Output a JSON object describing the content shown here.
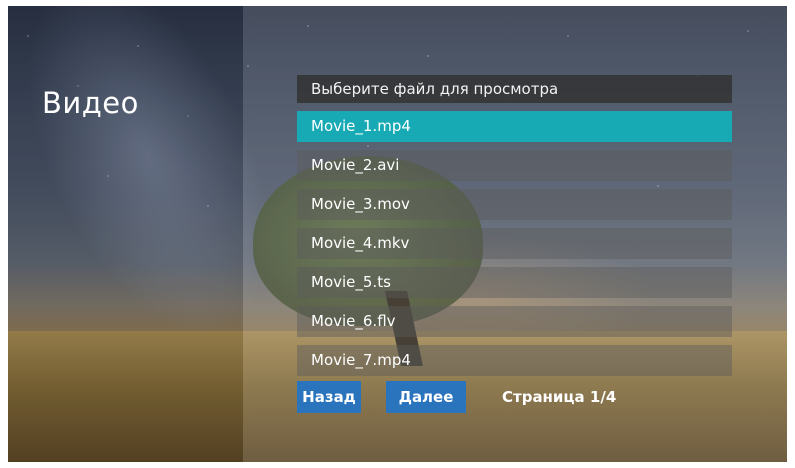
{
  "screen_title": "Видео",
  "file_list": {
    "header": "Выберите файл для просмотра",
    "items": [
      {
        "label": "Movie_1.mp4"
      },
      {
        "label": "Movie_2.avi"
      },
      {
        "label": "Movie_3.mov"
      },
      {
        "label": "Movie_4.mkv"
      },
      {
        "label": "Movie_5.ts"
      },
      {
        "label": "Movie_6.flv"
      },
      {
        "label": "Movie_7.mp4"
      }
    ],
    "selected_label": "Movie_1.mp4"
  },
  "pager": {
    "back_label": "Назад",
    "next_label": "Далее",
    "page_label": "Страница 1/4"
  },
  "colors": {
    "selected": "#17a9b4",
    "button": "#2a73bd"
  }
}
